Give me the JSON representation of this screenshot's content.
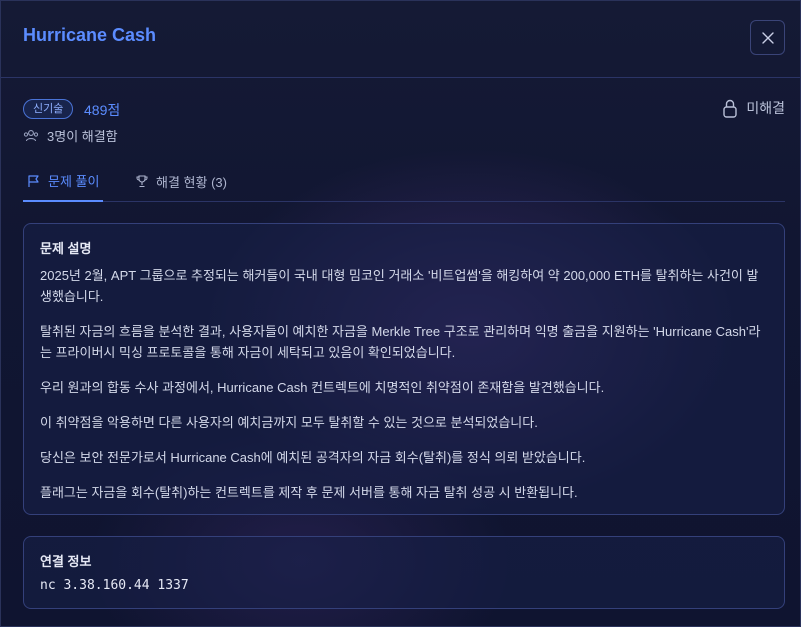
{
  "modal": {
    "title": "Hurricane Cash",
    "close_label": "close"
  },
  "meta": {
    "category": "신기술",
    "points": "489점",
    "solved_count": "3명이 해결함",
    "status": "미해결"
  },
  "tabs": [
    {
      "label": "문제 풀이",
      "active": true
    },
    {
      "label": "해결 현황 (3)",
      "active": false
    }
  ],
  "description": {
    "title": "문제 설명",
    "paragraphs": [
      "2025년 2월, APT 그룹으로 추정되는 해커들이 국내 대형 밈코인 거래소 '비트업썸'을 해킹하여 약 200,000 ETH를 탈취하는 사건이 발생했습니다.",
      "탈취된 자금의 흐름을 분석한 결과, 사용자들이 예치한 자금을 Merkle Tree 구조로 관리하며 익명 출금을 지원하는 'Hurricane Cash'라는 프라이버시 믹싱 프로토콜을 통해 자금이 세탁되고 있음이 확인되었습니다.",
      "우리 원과의 합동 수사 과정에서, Hurricane Cash 컨트렉트에 치명적인 취약점이 존재함을 발견했습니다.",
      "이 취약점을 악용하면 다른 사용자의 예치금까지 모두 탈취할 수 있는 것으로 분석되었습니다.",
      "당신은 보안 전문가로서 Hurricane Cash에 예치된 공격자의 자금 회수(탈취)를 정식 의뢰 받았습니다.",
      "플래그는 자금을 회수(탈취)하는 컨트렉트를 제작 후 문제 서버를 통해 자금 탈취 성공 시 반환됩니다."
    ]
  },
  "connection": {
    "title": "연결 정보",
    "value": "nc 3.38.160.44 1337"
  },
  "colors": {
    "accent": "#5b8cff",
    "background": "#111632",
    "card_border": "#34407a"
  }
}
